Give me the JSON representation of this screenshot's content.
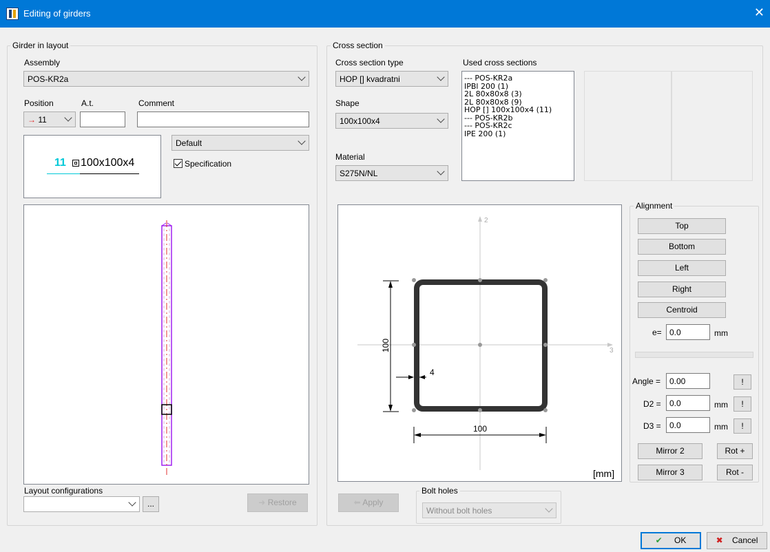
{
  "window": {
    "title": "Editing of girders",
    "close_glyph": "✕"
  },
  "girder_group": {
    "label": "Girder in layout",
    "assembly_label": "Assembly",
    "assembly_value": "POS-KR2a",
    "position_label": "Position",
    "position_value": "11",
    "position_arrow": "→",
    "at_label": "A.t.",
    "at_value": "",
    "comment_label": "Comment",
    "comment_value": "",
    "preview_number": "11",
    "preview_section": "100x100x4",
    "style_value": "Default",
    "specification_label": "Specification",
    "specification_checked": true,
    "layout_config_label": "Layout configurations",
    "layout_config_value": "",
    "ellipsis_label": "...",
    "restore_label": "Restore"
  },
  "cross_section_group": {
    "label": "Cross section",
    "type_label": "Cross section type",
    "type_value": "HOP [] kvadratni",
    "shape_label": "Shape",
    "shape_value": "100x100x4",
    "material_label": "Material",
    "material_value": "S275N/NL",
    "used_label": "Used cross sections",
    "used_items": [
      "--- POS-KR2a",
      "IPBl 200 (1)",
      "2L 80x80x8 (3)",
      "2L 80x80x8 (9)",
      "HOP [] 100x100x4 (11)",
      "--- POS-KR2b",
      "--- POS-KR2c",
      "IPE 200 (1)"
    ]
  },
  "drawing": {
    "axis2_label": "2",
    "axis3_label": "3",
    "dim_height": "100",
    "dim_width": "100",
    "dim_thickness": "4",
    "units": "[mm]"
  },
  "alignment": {
    "label": "Alignment",
    "buttons": [
      "Top",
      "Bottom",
      "Left",
      "Right",
      "Centroid"
    ],
    "e_label": "e=",
    "e_value": "0.0",
    "e_unit": "mm",
    "angle_label": "Angle =",
    "angle_value": "0.00",
    "d2_label": "D2 =",
    "d2_value": "0.0",
    "d2_unit": "mm",
    "d3_label": "D3 =",
    "d3_value": "0.0",
    "d3_unit": "mm",
    "excl_label": "!",
    "mirror2_label": "Mirror 2",
    "mirror3_label": "Mirror 3",
    "rot_plus_label": "Rot +",
    "rot_minus_label": "Rot -"
  },
  "bottom": {
    "apply_label": "Apply",
    "bolt_holes_label": "Bolt holes",
    "bolt_holes_value": "Without bolt holes",
    "ok_label": "OK",
    "cancel_label": "Cancel"
  },
  "colors": {
    "title_bar": "#0078d7",
    "girder_outline": "#a020f0",
    "centerline": "#e03030",
    "preview_number": "#00c8d8",
    "ok_icon": "#2e9e3a",
    "cancel_icon": "#d02020"
  }
}
